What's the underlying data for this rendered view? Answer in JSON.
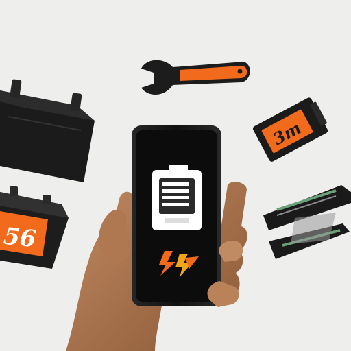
{
  "scene": {
    "background": "#eeeeed",
    "accent_color": "#f26a1b",
    "dark_color": "#1c1c1c"
  },
  "objects": {
    "wrench": {
      "icon": "wrench-icon"
    },
    "battery_top_left": {
      "icon": "car-battery-icon"
    },
    "battery_bottom_left": {
      "icon": "car-battery-icon",
      "label": "56"
    },
    "battery_right": {
      "icon": "battery-icon",
      "label": "3m"
    },
    "charger_right": {
      "icon": "charger-device-icon"
    },
    "phone": {
      "icon": "smartphone-icon",
      "screen": {
        "battery_icon": "battery-status-icon",
        "bolt_icon": "lightning-bolt-icon"
      }
    },
    "hand": {
      "icon": "hand-icon"
    }
  }
}
